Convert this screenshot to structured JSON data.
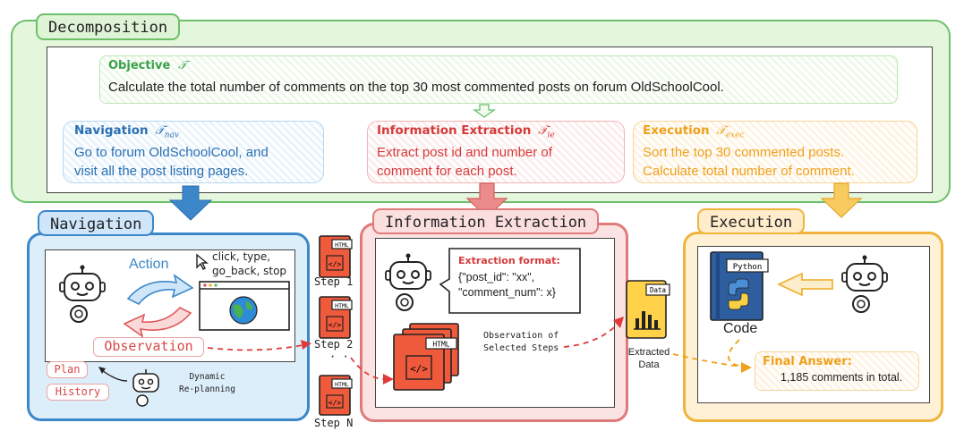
{
  "decomposition": {
    "tab": "Decomposition",
    "objective": {
      "label": "Objective",
      "symbol": "𝒯",
      "text": "Calculate the total number of comments on the top 30 most commented posts on forum OldSchoolCool."
    },
    "navigation": {
      "label": "Navigation",
      "symbol": "𝒯",
      "sub": "nav",
      "line1": "Go to forum OldSchoolCool, and",
      "line2": "visit all the post listing pages."
    },
    "information_extraction": {
      "label": "Information Extraction",
      "symbol": "𝒯",
      "sub": "ie",
      "line1": "Extract post id and number of",
      "line2": "comment for each post."
    },
    "execution": {
      "label": "Execution",
      "symbol": "𝒯",
      "sub": "exec",
      "line1": "Sort the top 30 commented posts.",
      "line2": "Calculate total number of comment."
    }
  },
  "navigation_panel": {
    "tab": "Navigation",
    "action_label": "Action",
    "actions_line1": "click, type,",
    "actions_line2": "go_back, stop",
    "observation_label": "Observation",
    "plan_label": "Plan",
    "history_label": "History",
    "replan_line1": "Dynamic",
    "replan_line2": "Re-planning"
  },
  "steps": {
    "step1": "Step 1",
    "step2": "Step 2",
    "ellipsis": "· ·",
    "stepn": "Step N",
    "html_tag": "HTML"
  },
  "ie_panel": {
    "tab": "Information Extraction",
    "format_title": "Extraction format:",
    "format_line1": "{\"post_id\": \"xx\",",
    "format_line2": "\"comment_num\": x}",
    "obs_line1": "Observation of",
    "obs_line2": "Selected Steps"
  },
  "extracted": {
    "tag": "Data",
    "line1": "Extracted",
    "line2": "Data"
  },
  "ex_panel": {
    "tab": "Execution",
    "python_tag": "Python",
    "code_label": "Code",
    "final_title": "Final Answer:",
    "final_value": "1,185 comments in total."
  },
  "colors": {
    "green": "#6cc06a",
    "blue": "#3b87c9",
    "red": "#e07a7a",
    "orange": "#f0b43c",
    "doc_red": "#ef5a3c"
  }
}
